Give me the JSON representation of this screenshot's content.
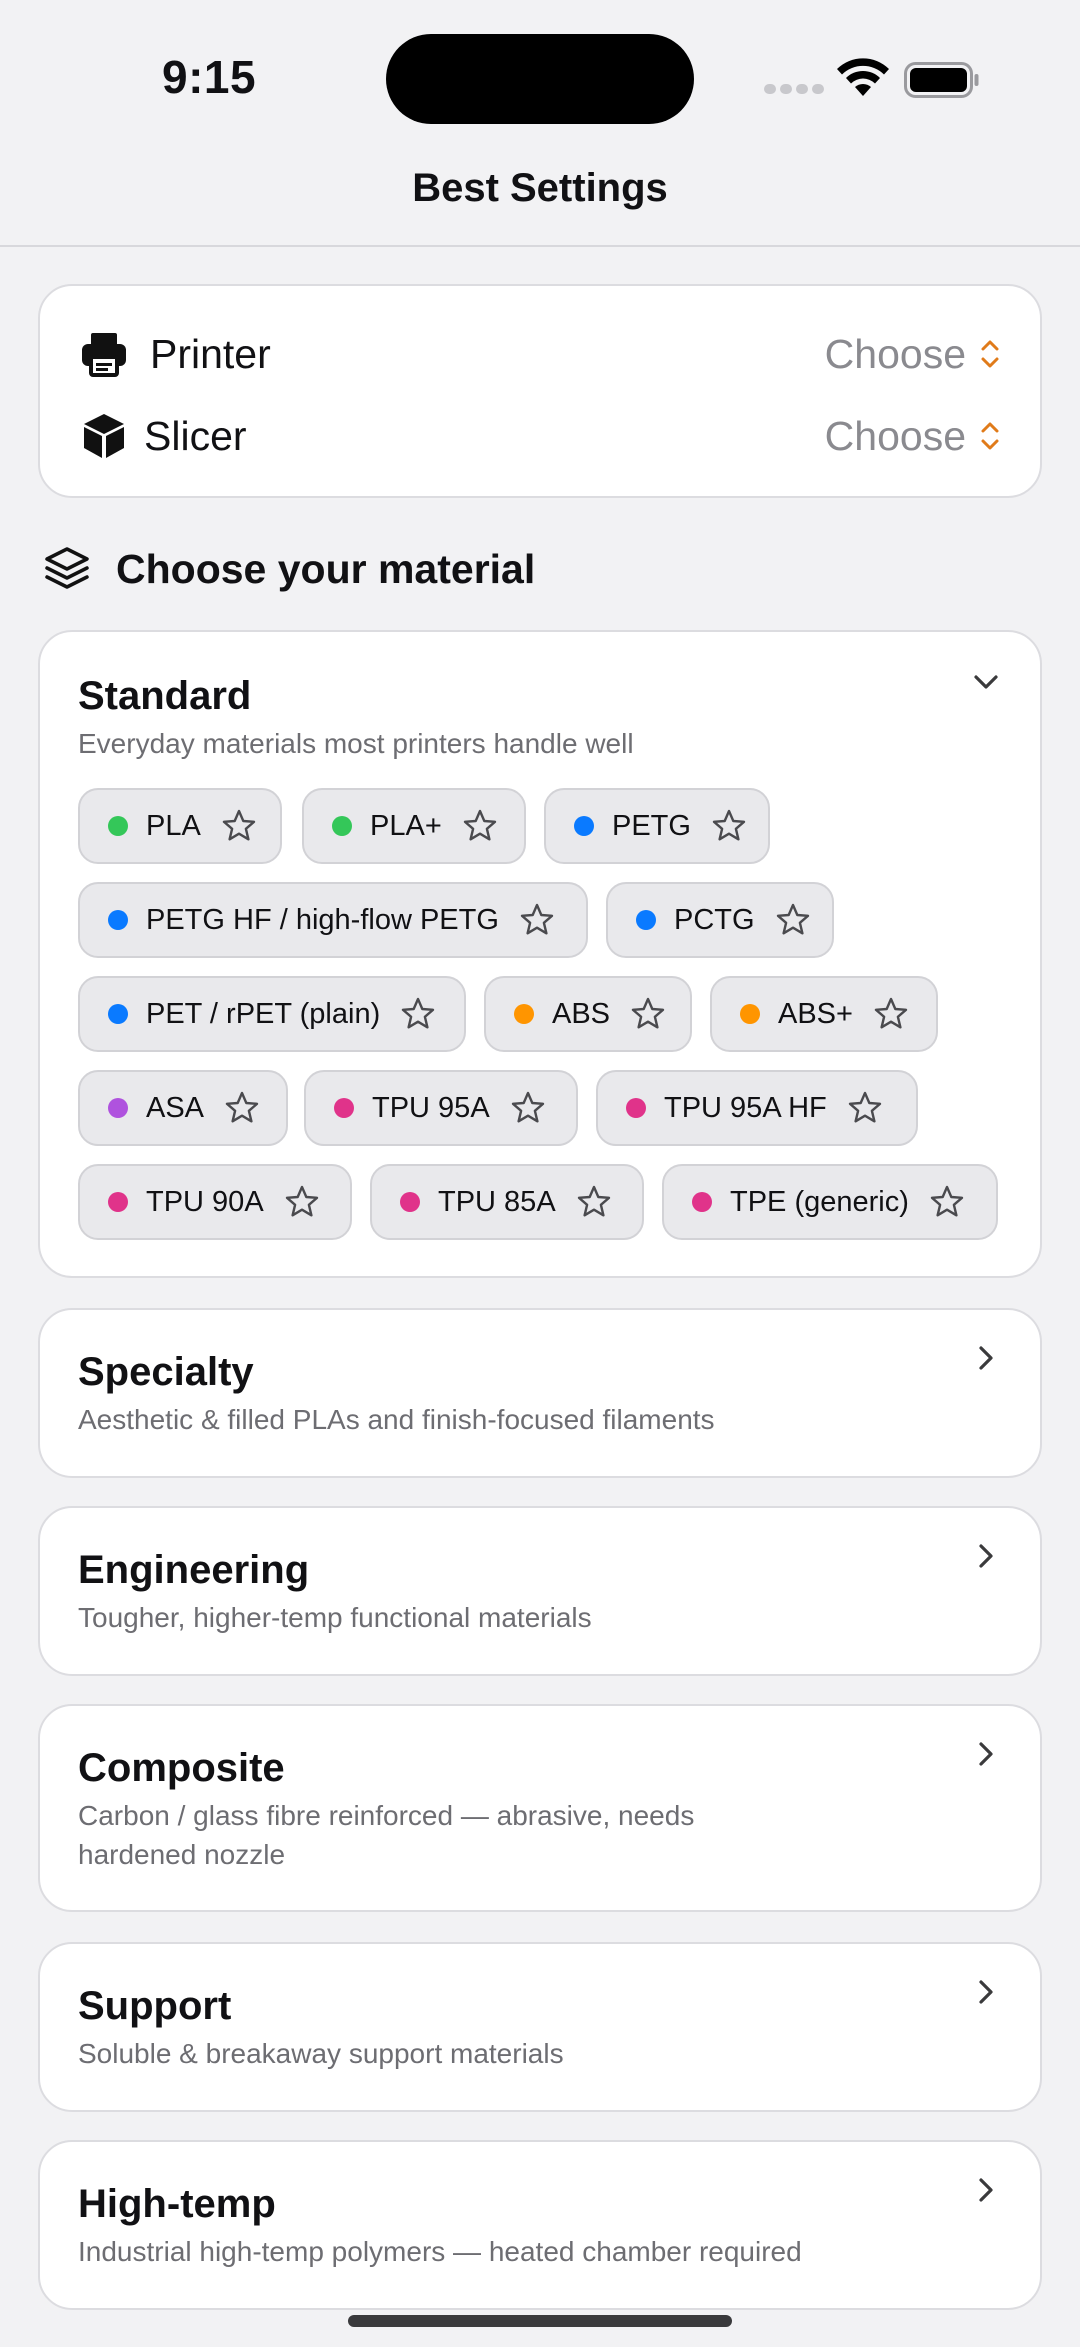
{
  "status_bar": {
    "time": "9:15"
  },
  "nav": {
    "title": "Best Settings"
  },
  "setup": {
    "printer_label": "Printer",
    "printer_value": "Choose",
    "slicer_label": "Slicer",
    "slicer_value": "Choose"
  },
  "material_section": {
    "title": "Choose your material"
  },
  "colors": {
    "green": "#34c759",
    "blue": "#0a7aff",
    "orange": "#ff9500",
    "purple": "#af52de",
    "pink": "#e0338a",
    "accent": "#e07b1a"
  },
  "categories": [
    {
      "title": "Standard",
      "subtitle": "Everyday materials most printers handle well",
      "expanded": true,
      "materials": [
        {
          "label": "PLA",
          "color": "#34c759"
        },
        {
          "label": "PLA+",
          "color": "#34c759"
        },
        {
          "label": "PETG",
          "color": "#0a7aff"
        },
        {
          "label": "PETG HF / high-flow PETG",
          "color": "#0a7aff"
        },
        {
          "label": "PCTG",
          "color": "#0a7aff"
        },
        {
          "label": "PET / rPET (plain)",
          "color": "#0a7aff"
        },
        {
          "label": "ABS",
          "color": "#ff9500"
        },
        {
          "label": "ABS+",
          "color": "#ff9500"
        },
        {
          "label": "ASA",
          "color": "#af52de"
        },
        {
          "label": "TPU 95A",
          "color": "#e0338a"
        },
        {
          "label": "TPU 95A HF",
          "color": "#e0338a"
        },
        {
          "label": "TPU 90A",
          "color": "#e0338a"
        },
        {
          "label": "TPU 85A",
          "color": "#e0338a"
        },
        {
          "label": "TPE (generic)",
          "color": "#e0338a"
        }
      ]
    },
    {
      "title": "Specialty",
      "subtitle": "Aesthetic & filled PLAs and finish-focused filaments"
    },
    {
      "title": "Engineering",
      "subtitle": "Tougher, higher-temp functional materials"
    },
    {
      "title": "Composite",
      "subtitle": "Carbon / glass fibre reinforced — abrasive, needs hardened nozzle"
    },
    {
      "title": "Support",
      "subtitle": "Soluble & breakaway support materials"
    },
    {
      "title": "High-temp",
      "subtitle": "Industrial high-temp polymers — heated chamber required"
    }
  ]
}
